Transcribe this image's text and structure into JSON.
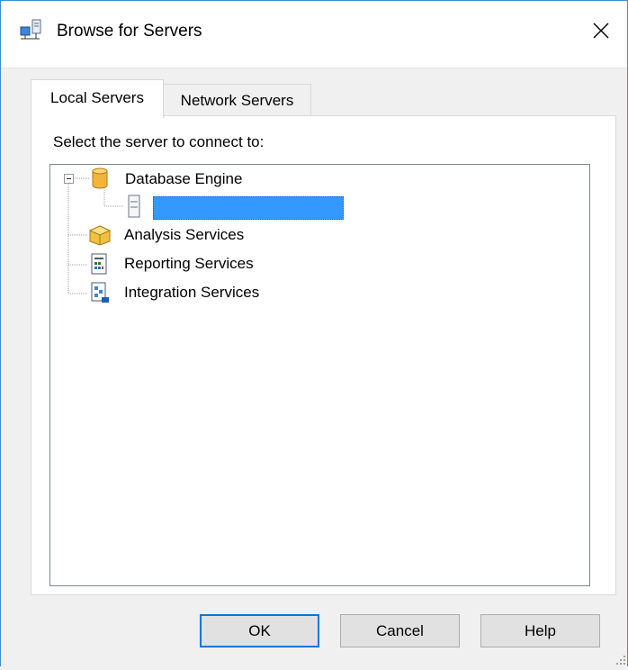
{
  "window": {
    "title": "Browse for Servers",
    "icon": "server-network-icon",
    "close_glyph": "✕"
  },
  "tabs": [
    {
      "label": "Local Servers",
      "selected": true
    },
    {
      "label": "Network Servers",
      "selected": false
    }
  ],
  "panel": {
    "prompt": "Select the server to connect to:"
  },
  "tree": {
    "nodes": [
      {
        "label": "Database Engine",
        "icon": "database-cylinder-icon",
        "expanded": true,
        "children": [
          {
            "label": "",
            "icon": "server-icon",
            "selected": true,
            "redacted": true
          }
        ]
      },
      {
        "label": "Analysis Services",
        "icon": "analysis-cube-icon"
      },
      {
        "label": "Reporting Services",
        "icon": "report-icon"
      },
      {
        "label": "Integration Services",
        "icon": "integration-package-icon"
      }
    ]
  },
  "buttons": {
    "ok": "OK",
    "cancel": "Cancel",
    "help": "Help"
  },
  "colors": {
    "selection": "#3399ff",
    "default_button_border": "#0078d7",
    "window_border": "#3b8ed8"
  }
}
